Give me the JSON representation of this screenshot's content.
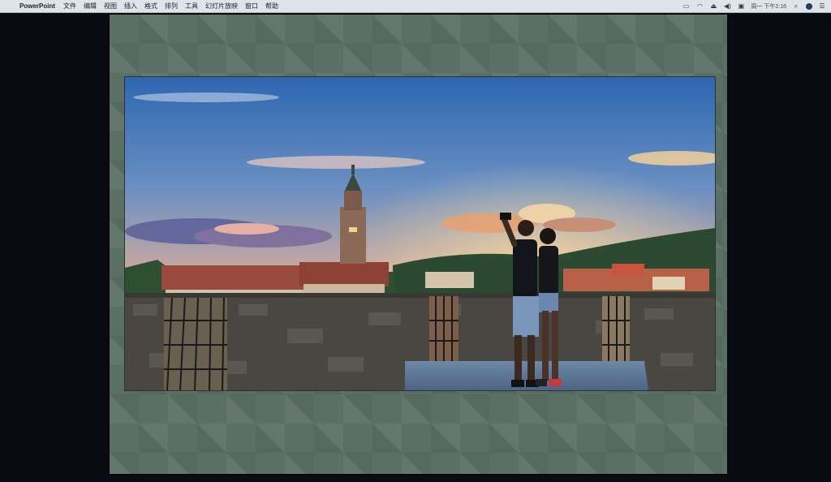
{
  "menubar": {
    "app_name": "PowerPoint",
    "items": [
      "文件",
      "编辑",
      "视图",
      "插入",
      "格式",
      "排列",
      "工具",
      "幻灯片放映",
      "窗口",
      "帮助"
    ],
    "clock": "周一 下午2:16",
    "status_icons": [
      "display-icon",
      "wifi-icon",
      "eject-icon",
      "volume-icon",
      "input-method-icon",
      "search-icon",
      "user-icon",
      "list-icon"
    ]
  },
  "slide": {
    "background_color": "#5b7064",
    "photo_subject": "couple-selfie-castle-sunset"
  }
}
